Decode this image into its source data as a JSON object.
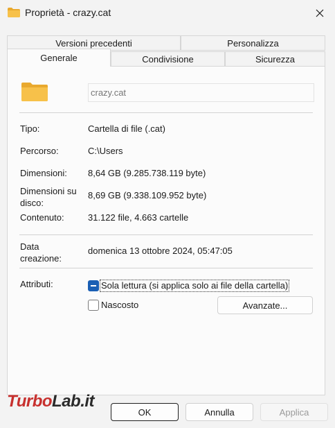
{
  "window": {
    "title": "Proprietà - crazy.cat",
    "accent": "#1a5fb4",
    "folder_color": "#f7c14a"
  },
  "tabs": {
    "row1": [
      {
        "label": "Versioni precedenti"
      },
      {
        "label": "Personalizza"
      }
    ],
    "row2": [
      {
        "label": "Generale",
        "active": true
      },
      {
        "label": "Condivisione"
      },
      {
        "label": "Sicurezza"
      }
    ]
  },
  "general": {
    "name_value": "crazy.cat",
    "type_label": "Tipo:",
    "type_value": "Cartella di file (.cat)",
    "path_label": "Percorso:",
    "path_value": "C:\\Users",
    "size_label": "Dimensioni:",
    "size_value": "8,64 GB (9.285.738.119 byte)",
    "disk_label_1": "Dimensioni su",
    "disk_label_2": "disco:",
    "disk_value": "8,69 GB (9.338.109.952 byte)",
    "contents_label": "Contenuto:",
    "contents_value": "31.122 file, 4.663 cartelle",
    "created_label_1": "Data",
    "created_label_2": "creazione:",
    "created_value": "domenica 13 ottobre 2024, 05:47:05",
    "attributes_label": "Attributi:",
    "readonly_label": "Sola lettura (si applica solo ai file della cartella)",
    "hidden_label": "Nascosto",
    "advanced_label": "Avanzate..."
  },
  "footer": {
    "ok_label": "OK",
    "cancel_label": "Annulla",
    "apply_label": "Applica"
  },
  "watermark": {
    "part1": "Turbo",
    "part2": "Lab.it"
  }
}
